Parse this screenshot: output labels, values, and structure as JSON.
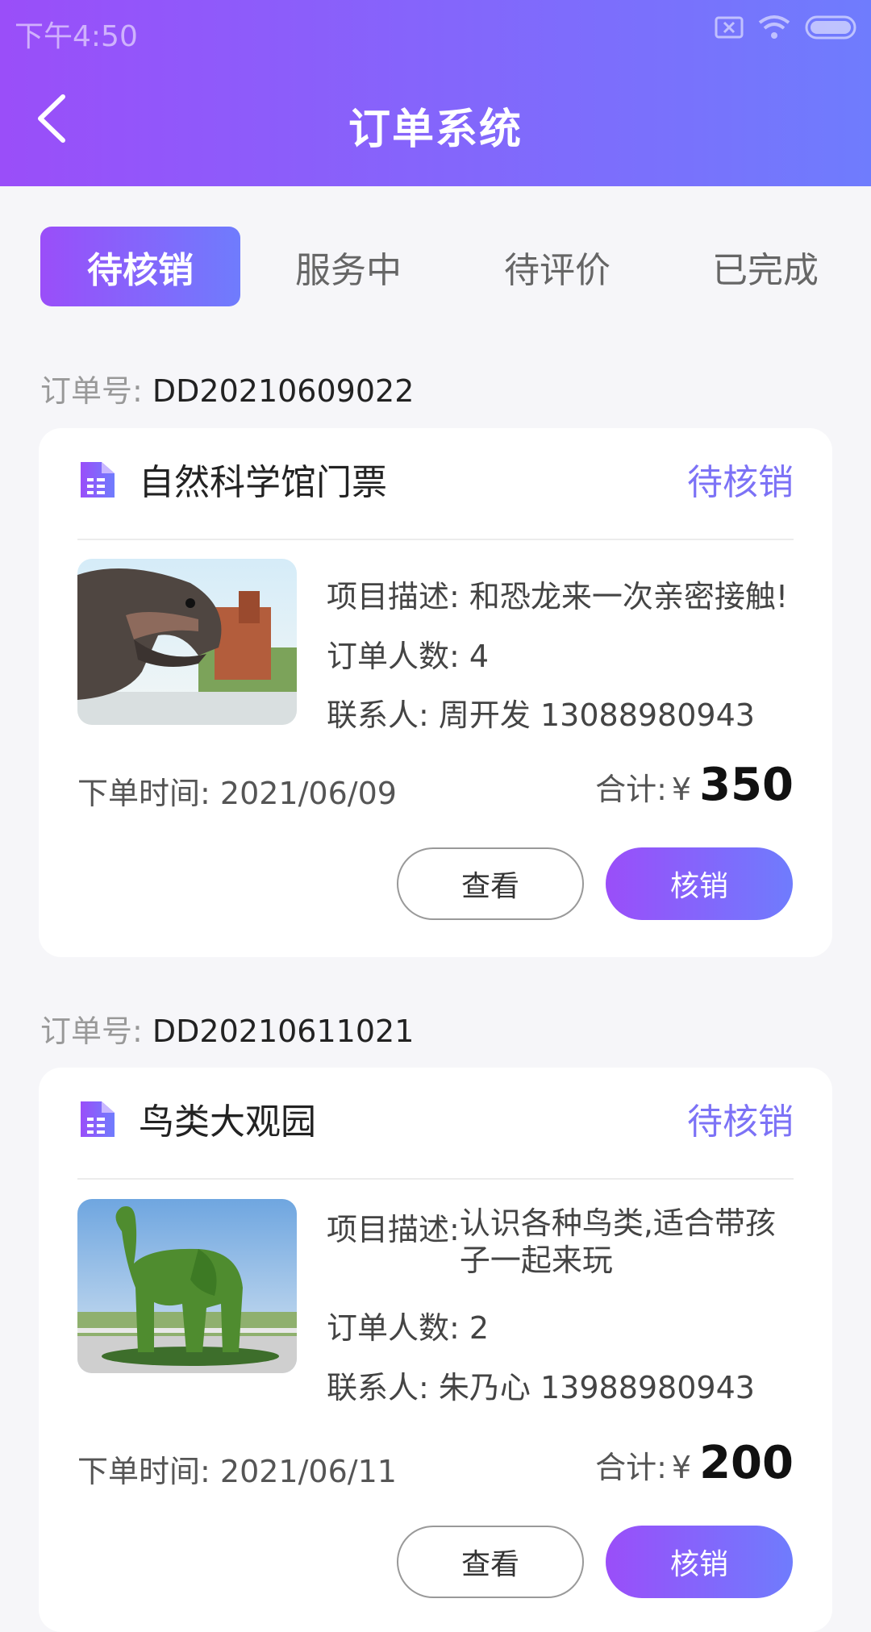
{
  "status_bar": {
    "time": "下午4:50"
  },
  "header": {
    "title": "订单系统"
  },
  "tabs": [
    {
      "label": "待核销",
      "active": true
    },
    {
      "label": "服务中",
      "active": false
    },
    {
      "label": "待评价",
      "active": false
    },
    {
      "label": "已完成",
      "active": false
    }
  ],
  "labels": {
    "order_no": "订单号:",
    "desc": "项目描述:",
    "people": "订单人数:",
    "contact": "联系人:",
    "order_time": "下单时间:",
    "total": "合计:",
    "currency": "¥",
    "view_button": "查看",
    "verify_button": "核销"
  },
  "orders": [
    {
      "order_no": "DD20210609022",
      "title": "自然科学馆门票",
      "status": "待核销",
      "desc": "和恐龙来一次亲密接触!",
      "people": "4",
      "contact": "周开发 13088980943",
      "order_time": "2021/06/09",
      "total": "350",
      "image": "dinosaur-photo"
    },
    {
      "order_no": "DD20210611021",
      "title": "鸟类大观园",
      "status": "待核销",
      "desc": "认识各种鸟类,适合带孩子一起来玩",
      "people": "2",
      "contact": "朱乃心 13988980943",
      "order_time": "2021/06/11",
      "total": "200",
      "image": "topiary-elephant-photo"
    }
  ],
  "colors": {
    "gradient_start": "#9a4ef9",
    "gradient_end": "#6f7cfd",
    "status_text": "#7c72f6"
  }
}
